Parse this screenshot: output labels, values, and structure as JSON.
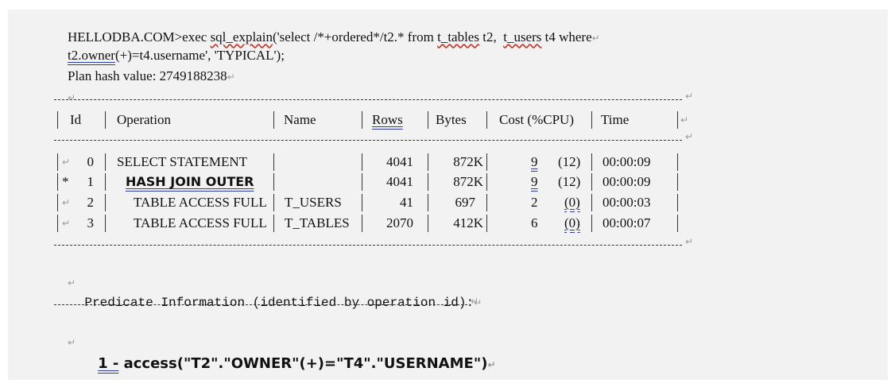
{
  "command": {
    "prompt": "HELLODBA.COM>exec",
    "proc": "sql_explain",
    "sql_part1": "('select /*+ordered*/t2.* from ",
    "tbl1": "t_tables",
    "sql_part2": " t2,  ",
    "tbl2": "t_users",
    "sql_part3": " t4 where",
    "line2_a": "t2.owner",
    "line2_b": "(+)=t4.username', 'TYPICAL');"
  },
  "plan_hash": "Plan hash value: 2749188238",
  "para_mark": "↵",
  "table": {
    "headers": {
      "id": "Id",
      "operation": "Operation",
      "name": "Name",
      "rows": "Rows",
      "bytes": "Bytes",
      "cost": "Cost (%CPU)",
      "time": "Time"
    },
    "rows": [
      {
        "star": "",
        "id": "0",
        "operation": "SELECT STATEMENT",
        "name": "",
        "rows": "4041",
        "bytes": "872K",
        "cost": "9",
        "cpu": "(12)",
        "time": "00:00:09"
      },
      {
        "star": "*",
        "id": "1",
        "operation": "HASH JOIN OUTER",
        "name": "",
        "rows": "4041",
        "bytes": "872K",
        "cost": "9",
        "cpu": "(12)",
        "time": "00:00:09"
      },
      {
        "star": "",
        "id": "2",
        "operation": "TABLE ACCESS FULL",
        "name": "T_USERS",
        "rows": "41",
        "bytes": "697",
        "cost": "2",
        "cpu": "(0)",
        "time": "00:00:03"
      },
      {
        "star": "",
        "id": "3",
        "operation": "TABLE ACCESS FULL",
        "name": "T_TABLES",
        "rows": "2070",
        "bytes": "412K",
        "cost": "6",
        "cpu": "(0)",
        "time": "00:00:07"
      }
    ]
  },
  "predicate": {
    "heading": "Predicate Information (identified by operation id):",
    "id_label": "1 -",
    "text": " access(\"T2\".\"OWNER\"(+)=\"T4\".\"USERNAME\")"
  }
}
